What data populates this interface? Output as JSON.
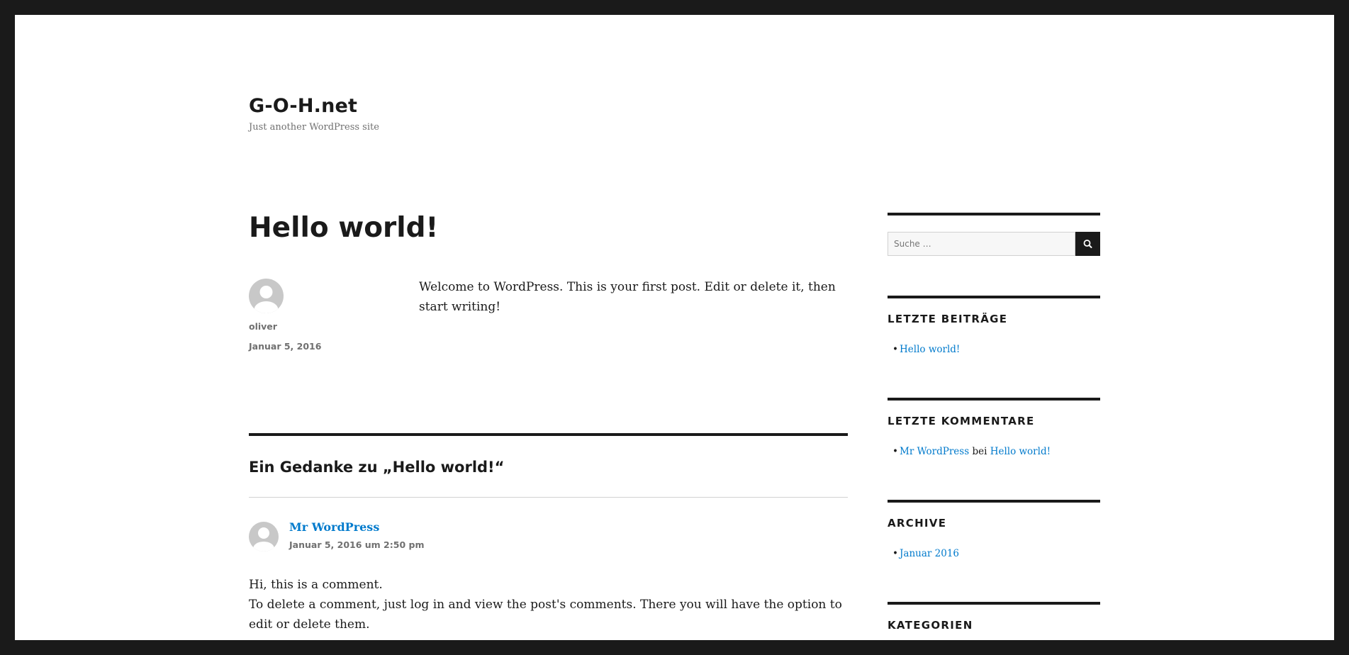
{
  "site": {
    "title": "G-O-H.net",
    "tagline": "Just another WordPress site"
  },
  "post": {
    "title": "Hello world!",
    "author": "oliver",
    "date": "Januar 5, 2016",
    "body": "Welcome to WordPress. This is your first post. Edit or delete it, then start writing!"
  },
  "comments": {
    "title": "Ein Gedanke zu „Hello world!“",
    "items": [
      {
        "author": "Mr WordPress",
        "date": "Januar 5, 2016 um 2:50 pm",
        "line1": "Hi, this is a comment.",
        "line2": "To delete a comment, just log in and view the post's comments. There you will have the option to edit or delete them."
      }
    ]
  },
  "sidebar": {
    "search_placeholder": "Suche …",
    "search_icon": "search-icon",
    "recent_posts": {
      "title": "LETZTE BEITRÄGE",
      "items": [
        "Hello world!"
      ]
    },
    "recent_comments": {
      "title": "LETZTE KOMMENTARE",
      "items": [
        {
          "author": "Mr WordPress",
          "connector": "bei",
          "post": "Hello world!"
        }
      ]
    },
    "archive": {
      "title": "ARCHIVE",
      "items": [
        "Januar 2016"
      ]
    },
    "categories": {
      "title": "KATEGORIEN"
    }
  },
  "colors": {
    "frame": "#1a1a1a",
    "background": "#ffffff",
    "link": "#007acc",
    "text": "#1a1a1a",
    "meta": "#707070"
  }
}
